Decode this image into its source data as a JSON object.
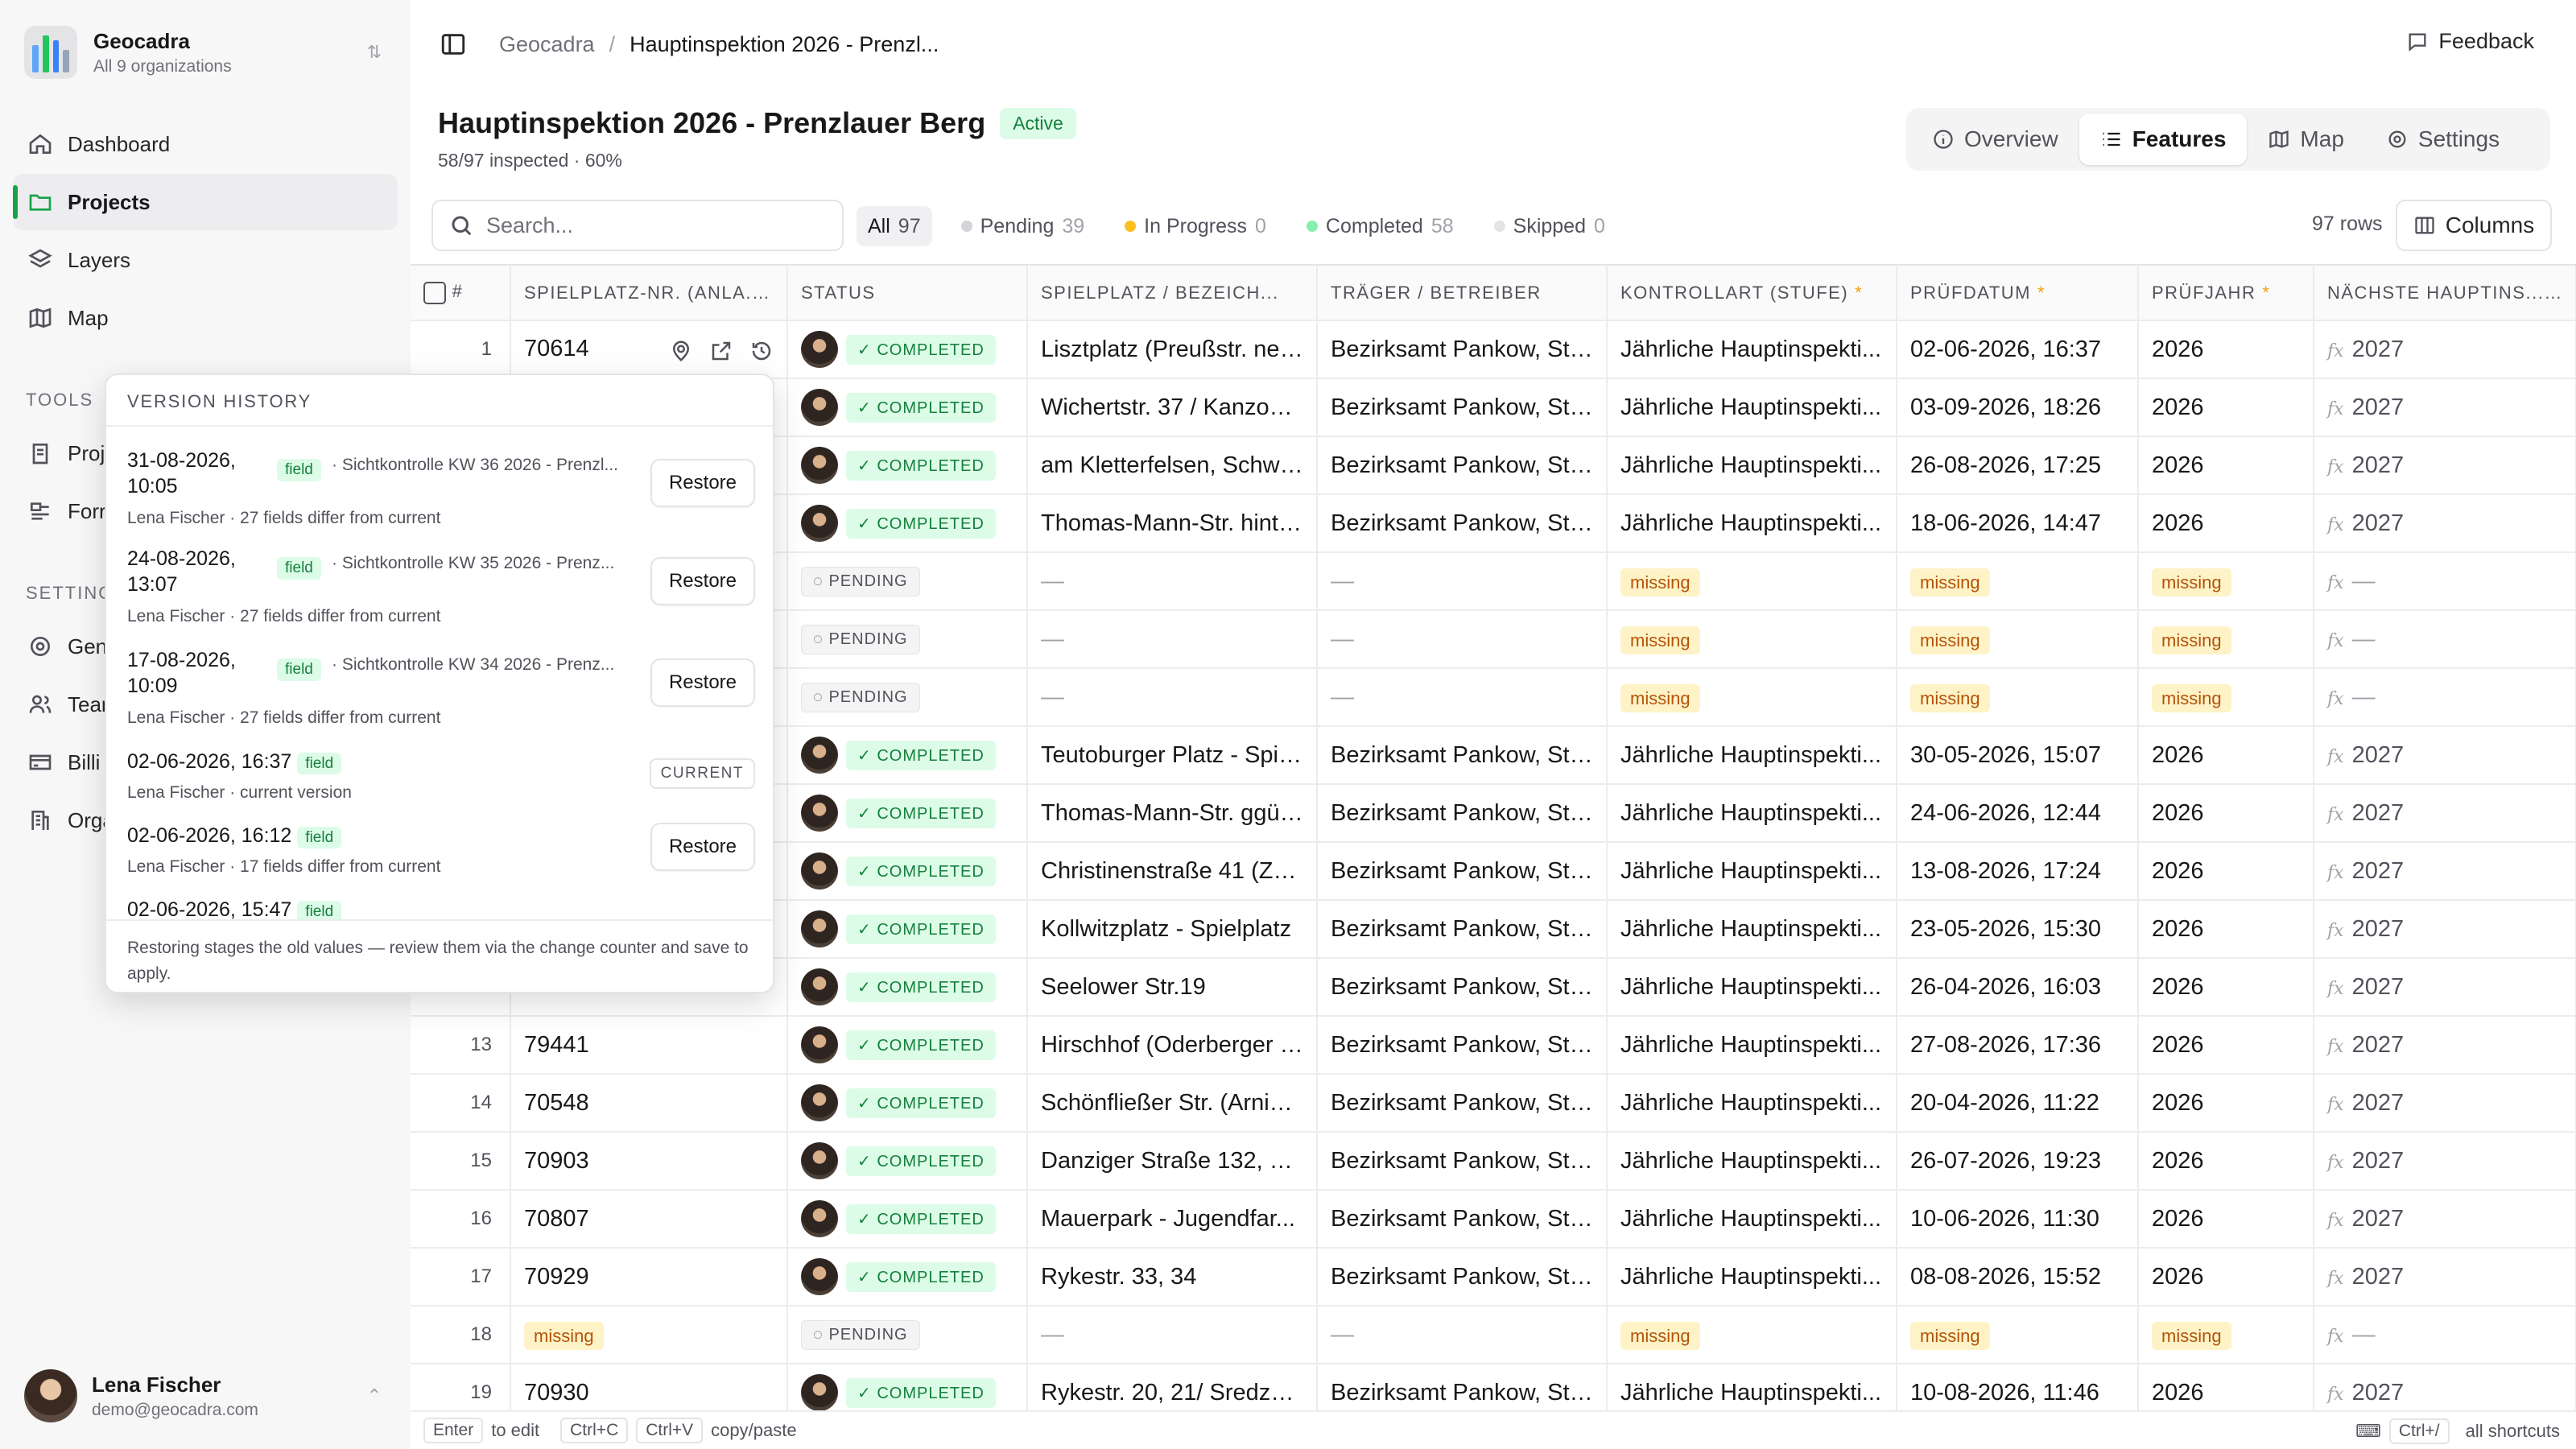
{
  "org": {
    "name": "Geocadra",
    "sub": "All 9 organizations"
  },
  "nav": {
    "dashboard": "Dashboard",
    "projects": "Projects",
    "layers": "Layers",
    "map": "Map",
    "tools_label": "TOOLS",
    "tools_1": "Proj",
    "tools_2": "Forr",
    "settings_label": "SETTING",
    "settings_1": "Gen",
    "settings_2": "Tean",
    "settings_3": "Billi",
    "settings_4": "Orga"
  },
  "user": {
    "name": "Lena Fischer",
    "email": "demo@geocadra.com"
  },
  "breadcrumb": {
    "root": "Geocadra",
    "sep": "/",
    "current": "Hauptinspektion 2026 - Prenzl..."
  },
  "feedback_label": "Feedback",
  "project": {
    "title": "Hauptinspektion 2026 - Prenzlauer Berg",
    "status": "Active",
    "progress_text": "58/97 inspected · 60%",
    "progress": 0.6
  },
  "tabs": [
    "Overview",
    "Features",
    "Map",
    "Settings"
  ],
  "search": {
    "placeholder": "Search..."
  },
  "filters": [
    {
      "label": "All",
      "count": "97"
    },
    {
      "label": "Pending",
      "count": "39"
    },
    {
      "label": "In Progress",
      "count": "0"
    },
    {
      "label": "Completed",
      "count": "58"
    },
    {
      "label": "Skipped",
      "count": "0"
    }
  ],
  "rows_count": "97 rows",
  "columns_label": "Columns",
  "headers": [
    "#",
    "SPIELPLATZ-NR. (ANLA...",
    "STATUS",
    "SPIELPLATZ / BEZEICH...",
    "TRÄGER / BETREIBER",
    "KONTROLLART (STUFE)",
    "PRÜFDATUM",
    "PRÜFJAHR",
    "NÄCHSTE HAUPTINS..."
  ],
  "rows": [
    {
      "n": "1",
      "nr": "70614",
      "status": "COMPLETED",
      "name": "Lisztplatz (Preußstr. neb...",
      "traeger": "Bezirksamt Pankow, Str...",
      "art": "Jährliche Hauptinspekti...",
      "datum": "02-06-2026, 16:37",
      "jahr": "2026",
      "next": "2027"
    },
    {
      "n": "2",
      "nr": "",
      "status": "COMPLETED",
      "name": "Wichertstr. 37 / Kanzow...",
      "traeger": "Bezirksamt Pankow, Str...",
      "art": "Jährliche Hauptinspekti...",
      "datum": "03-09-2026, 18:26",
      "jahr": "2026",
      "next": "2027"
    },
    {
      "n": "3",
      "nr": "",
      "status": "COMPLETED",
      "name": "am Kletterfelsen, Schwe...",
      "traeger": "Bezirksamt Pankow, Str...",
      "art": "Jährliche Hauptinspekti...",
      "datum": "26-08-2026, 17:25",
      "jahr": "2026",
      "next": "2027"
    },
    {
      "n": "4",
      "nr": "",
      "status": "COMPLETED",
      "name": "Thomas-Mann-Str. hinte...",
      "traeger": "Bezirksamt Pankow, Str...",
      "art": "Jährliche Hauptinspekti...",
      "datum": "18-06-2026, 14:47",
      "jahr": "2026",
      "next": "2027"
    },
    {
      "n": "5",
      "nr": "",
      "status": "PENDING",
      "name": "—",
      "traeger": "—",
      "art": "missing",
      "datum": "missing",
      "jahr": "missing",
      "next": "—"
    },
    {
      "n": "6",
      "nr": "",
      "status": "PENDING",
      "name": "—",
      "traeger": "—",
      "art": "missing",
      "datum": "missing",
      "jahr": "missing",
      "next": "—"
    },
    {
      "n": "7",
      "nr": "",
      "status": "PENDING",
      "name": "—",
      "traeger": "—",
      "art": "missing",
      "datum": "missing",
      "jahr": "missing",
      "next": "—"
    },
    {
      "n": "8",
      "nr": "",
      "status": "COMPLETED",
      "name": "Teutoburger Platz - Spie...",
      "traeger": "Bezirksamt Pankow, Str...",
      "art": "Jährliche Hauptinspekti...",
      "datum": "30-05-2026, 15:07",
      "jahr": "2026",
      "next": "2027"
    },
    {
      "n": "9",
      "nr": "",
      "status": "COMPLETED",
      "name": "Thomas-Mann-Str. ggü. ...",
      "traeger": "Bezirksamt Pankow, Str...",
      "art": "Jährliche Hauptinspekti...",
      "datum": "24-06-2026, 12:44",
      "jahr": "2026",
      "next": "2027"
    },
    {
      "n": "10",
      "nr": "",
      "status": "COMPLETED",
      "name": "Christinenstraße 41 (Zeh...",
      "traeger": "Bezirksamt Pankow, Str...",
      "art": "Jährliche Hauptinspekti...",
      "datum": "13-08-2026, 17:24",
      "jahr": "2026",
      "next": "2027"
    },
    {
      "n": "11",
      "nr": "",
      "status": "COMPLETED",
      "name": "Kollwitzplatz - Spielplatz",
      "traeger": "Bezirksamt Pankow, Str...",
      "art": "Jährliche Hauptinspekti...",
      "datum": "23-05-2026, 15:30",
      "jahr": "2026",
      "next": "2027"
    },
    {
      "n": "12",
      "nr": "",
      "status": "COMPLETED",
      "name": "Seelower Str.19",
      "traeger": "Bezirksamt Pankow, Str...",
      "art": "Jährliche Hauptinspekti...",
      "datum": "26-04-2026, 16:03",
      "jahr": "2026",
      "next": "2027"
    },
    {
      "n": "13",
      "nr": "79441",
      "status": "COMPLETED",
      "name": "Hirschhof (Oderberger S...",
      "traeger": "Bezirksamt Pankow, Str...",
      "art": "Jährliche Hauptinspekti...",
      "datum": "27-08-2026, 17:36",
      "jahr": "2026",
      "next": "2027"
    },
    {
      "n": "14",
      "nr": "70548",
      "status": "COMPLETED",
      "name": "Schönfließer Str. (Arnim...",
      "traeger": "Bezirksamt Pankow, Str...",
      "art": "Jährliche Hauptinspekti...",
      "datum": "20-04-2026, 11:22",
      "jahr": "2026",
      "next": "2027"
    },
    {
      "n": "15",
      "nr": "70903",
      "status": "COMPLETED",
      "name": "Danziger Straße 132, 13...",
      "traeger": "Bezirksamt Pankow, Str...",
      "art": "Jährliche Hauptinspekti...",
      "datum": "26-07-2026, 19:23",
      "jahr": "2026",
      "next": "2027"
    },
    {
      "n": "16",
      "nr": "70807",
      "status": "COMPLETED",
      "name": "Mauerpark - Jugendfar...",
      "traeger": "Bezirksamt Pankow, Str...",
      "art": "Jährliche Hauptinspekti...",
      "datum": "10-06-2026, 11:30",
      "jahr": "2026",
      "next": "2027"
    },
    {
      "n": "17",
      "nr": "70929",
      "status": "COMPLETED",
      "name": "Rykestr. 33, 34",
      "traeger": "Bezirksamt Pankow, Str...",
      "art": "Jährliche Hauptinspekti...",
      "datum": "08-08-2026, 15:52",
      "jahr": "2026",
      "next": "2027"
    },
    {
      "n": "18",
      "nr": "missing",
      "status": "PENDING",
      "name": "—",
      "traeger": "—",
      "art": "missing",
      "datum": "missing",
      "jahr": "missing",
      "next": "—"
    },
    {
      "n": "19",
      "nr": "70930",
      "status": "COMPLETED",
      "name": "Rykestr. 20, 21/ Sredzki...",
      "traeger": "Bezirksamt Pankow, Str...",
      "art": "Jährliche Hauptinspekti...",
      "datum": "10-08-2026, 11:46",
      "jahr": "2026",
      "next": "2027"
    }
  ],
  "history": {
    "title": "VERSION HISTORY",
    "field_tag": "field",
    "restore_label": "Restore",
    "current_label": "CURRENT",
    "items": [
      {
        "date_a": "31-08-2026,",
        "date_b": "10:05",
        "desc": "· Sichtkontrolle KW 36 2026 - Prenzl...",
        "meta": "Lena Fischer · 27 fields differ from current"
      },
      {
        "date_a": "24-08-2026,",
        "date_b": "13:07",
        "desc": "· Sichtkontrolle KW 35 2026 - Prenz...",
        "meta": "Lena Fischer · 27 fields differ from current"
      },
      {
        "date_a": "17-08-2026,",
        "date_b": "10:09",
        "desc": "· Sichtkontrolle KW 34 2026 - Prenz...",
        "meta": "Lena Fischer · 27 fields differ from current"
      },
      {
        "date_a": "02-06-2026, 16:37",
        "date_b": "",
        "desc": "",
        "meta": "Lena Fischer · current version"
      },
      {
        "date_a": "02-06-2026, 16:12",
        "date_b": "",
        "desc": "",
        "meta": "Lena Fischer · 17 fields differ from current"
      },
      {
        "date_a": "02-06-2026, 15:47",
        "date_b": "",
        "desc": "",
        "meta": ""
      }
    ],
    "footer": "Restoring stages the old values — review them via the change counter and save to apply."
  },
  "bottombar": {
    "enter_key": "Enter",
    "enter_label": "to edit",
    "copy_key": "Ctrl+C",
    "paste_key": "Ctrl+V",
    "copy_label": "copy/paste",
    "shortcut_key": "Ctrl+/",
    "shortcut_label": "all shortcuts"
  },
  "colors": {
    "accent": "#16a34a",
    "completed_bg": "#dcfce7",
    "missing_bg": "#fef3c7",
    "pending_dot": "#d4d4d8",
    "progress_dot": "#fbbf24",
    "completed_dot": "#86efac"
  }
}
